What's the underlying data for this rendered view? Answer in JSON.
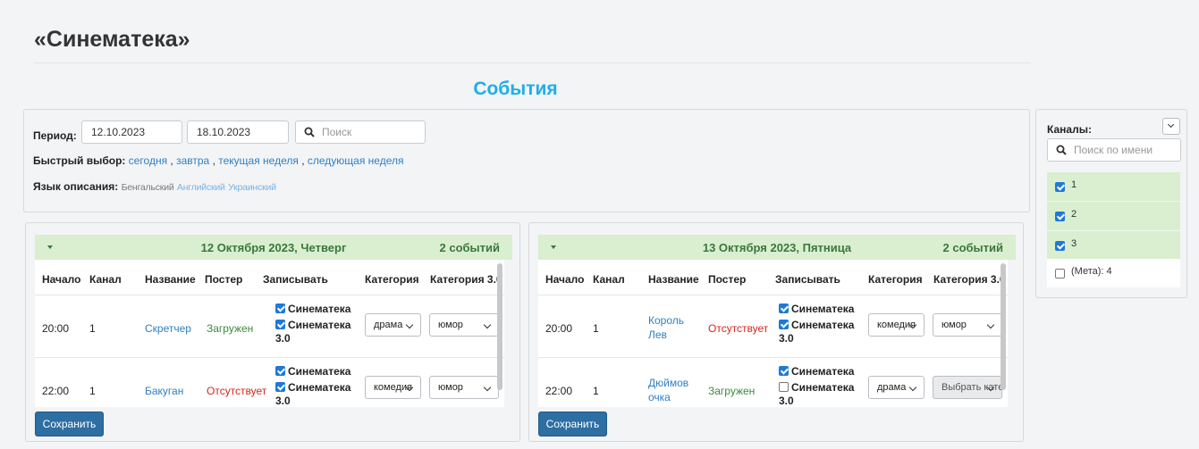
{
  "site_title": "«Синематека»",
  "page_heading": "События",
  "filters": {
    "period_label": "Период:",
    "date_from": "12.10.2023",
    "date_to": "18.10.2023",
    "search_placeholder": "Поиск",
    "quick_label": "Быстрый выбор:",
    "quick_links": [
      "сегодня",
      "завтра",
      "текущая неделя",
      "следующая неделя"
    ],
    "lang_label": "Язык описания:",
    "languages": [
      "Бенгальский",
      "Английский",
      "Украинский"
    ]
  },
  "columns": {
    "start": "Начало",
    "channel": "Канал",
    "name": "Название",
    "poster": "Постер",
    "record": "Записывать",
    "category": "Категория",
    "category3": "Категория 3.0"
  },
  "days": [
    {
      "date": "12 Октября 2023, Четверг",
      "count": "2 событий",
      "rows": [
        {
          "start": "20:00",
          "channel": "1",
          "name": "Скретчер",
          "poster": "Загружен",
          "poster_color": "#3c8a3c",
          "rec1": "Синематека",
          "rec1_checked": true,
          "rec2": "Синематека 3.0",
          "rec2_checked": true,
          "category": "драма",
          "category3": "юмор"
        },
        {
          "start": "22:00",
          "channel": "1",
          "name": "Бакуган",
          "poster": "Отсутствует",
          "poster_color": "#d9251d",
          "rec1": "Синематека",
          "rec1_checked": true,
          "rec2": "Синематека 3.0",
          "rec2_checked": true,
          "category": "комедия",
          "category3": "юмор"
        }
      ],
      "save_label": "Сохранить"
    },
    {
      "date": "13 Октября 2023, Пятница",
      "count": "2 событий",
      "rows": [
        {
          "start": "20:00",
          "channel": "1",
          "name": "Король Лев",
          "poster": "Отсутствует",
          "poster_color": "#d9251d",
          "rec1": "Синематека",
          "rec1_checked": true,
          "rec2": "Синематека 3.0",
          "rec2_checked": true,
          "category": "комедия",
          "category3": "юмор"
        },
        {
          "start": "22:00",
          "channel": "1",
          "name": "Дюймовочка",
          "poster": "Загружен",
          "poster_color": "#3c8a3c",
          "rec1": "Синематека",
          "rec1_checked": true,
          "rec2": "Синематека 3.0",
          "rec2_checked": false,
          "category": "драма",
          "category3": "Выбрать категорию"
        }
      ],
      "save_label": "Сохранить"
    }
  ],
  "channels": {
    "title": "Каналы:",
    "search_placeholder": "Поиск по имени",
    "items": [
      {
        "label": "1",
        "checked": true
      },
      {
        "label": "2",
        "checked": true
      },
      {
        "label": "3",
        "checked": true
      },
      {
        "label": "(Мета): 4",
        "checked": false
      }
    ]
  }
}
